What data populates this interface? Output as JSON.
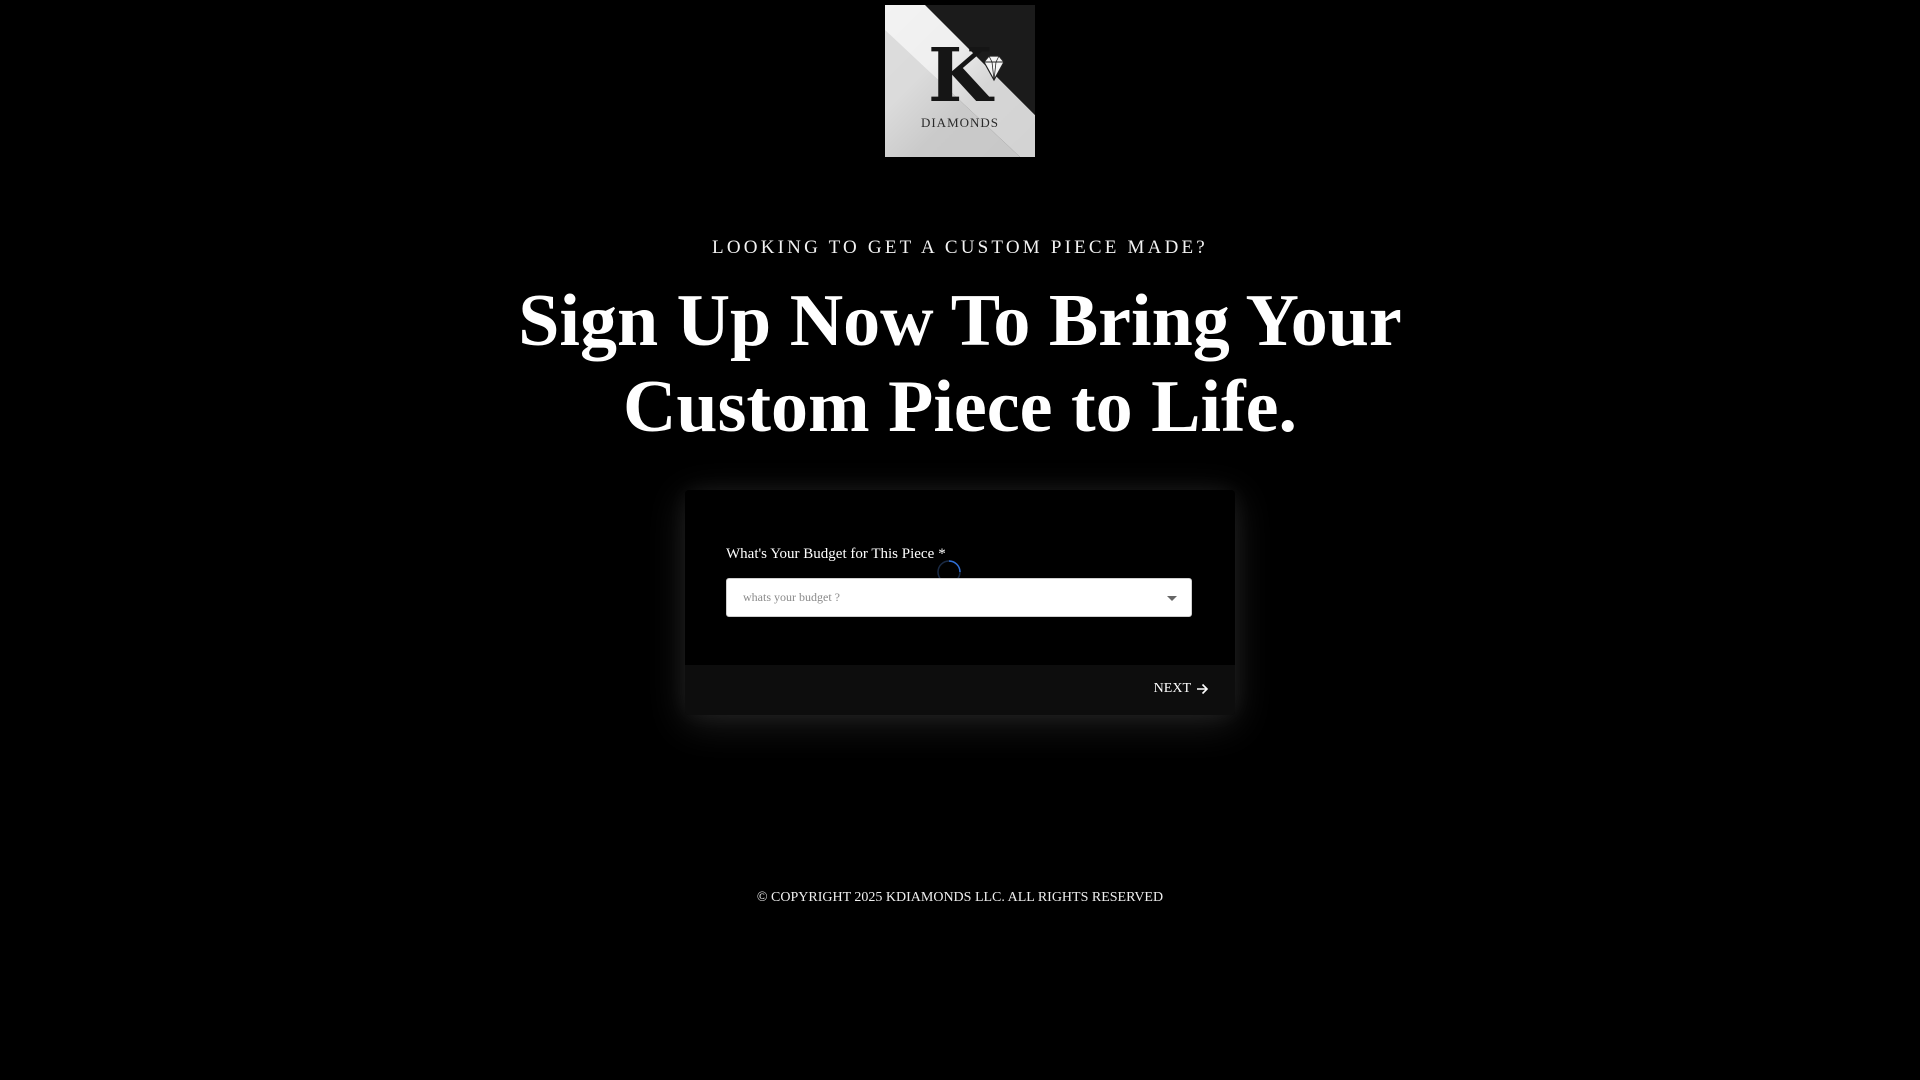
{
  "brand": {
    "logo_letter": "K",
    "logo_text": "DIAMONDS",
    "logo_icon": "diamond-icon"
  },
  "hero": {
    "eyebrow": "LOOKING TO GET A CUSTOM PIECE MADE?",
    "headline": "Sign Up Now To Bring Your Custom Piece to Life."
  },
  "form": {
    "budget_label": "What's Your Budget for This Piece",
    "required_mark": "*",
    "budget_placeholder": "whats your budget ?",
    "next_label": "NEXT",
    "next_icon": "arrow-right-icon",
    "accent_color": "#2f6fd6"
  },
  "footer": {
    "copyright": "© COPYRIGHT 2025 KDIAMONDS LLC. ALL RIGHTS RESERVED"
  }
}
